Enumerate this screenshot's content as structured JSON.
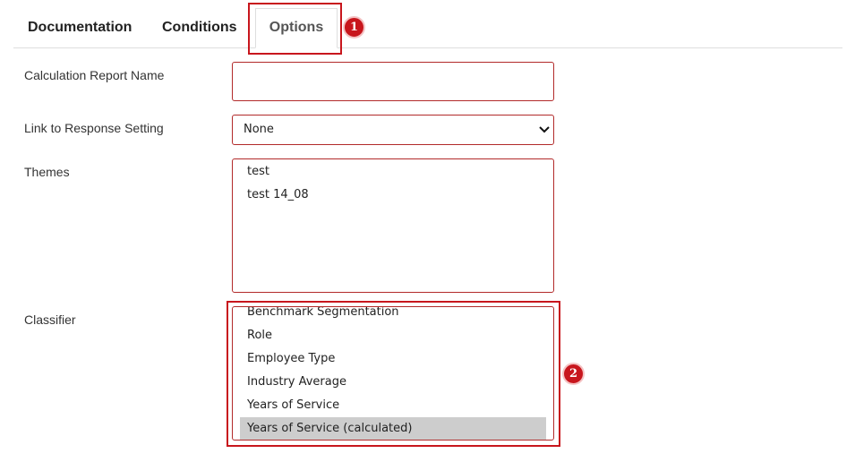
{
  "tabs": [
    {
      "label": "Documentation"
    },
    {
      "label": "Conditions"
    },
    {
      "label": "Options"
    }
  ],
  "annotations": [
    "1",
    "2"
  ],
  "form": {
    "report_name": {
      "label": "Calculation Report Name",
      "value": ""
    },
    "response_setting": {
      "label": "Link to Response Setting",
      "value": "None"
    },
    "themes": {
      "label": "Themes",
      "options": [
        "test",
        "test 14_08"
      ]
    },
    "classifier": {
      "label": "Classifier",
      "options": [
        "Benchmark Segmentation",
        "Role",
        "Employee Type",
        "Industry Average",
        "Years of Service",
        "Years of Service (calculated)"
      ],
      "selected": "Years of Service (calculated)"
    }
  },
  "colors": {
    "highlight": "#c8161d",
    "field_border": "#b22a2a",
    "selected_option": "#cdcdcd"
  }
}
